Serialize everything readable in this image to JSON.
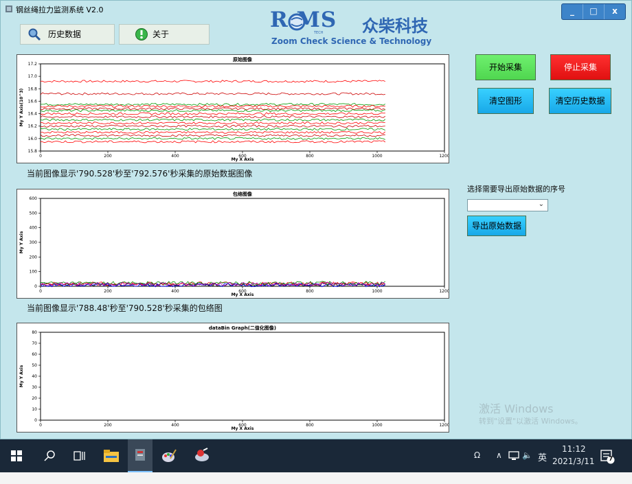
{
  "window": {
    "title": "钢丝绳拉力监测系统 V2.0",
    "controls": [
      "_",
      "□",
      "x"
    ]
  },
  "tabs": [
    {
      "label": "历史数据",
      "icon": "search-icon"
    },
    {
      "label": "关于",
      "icon": "info-icon"
    }
  ],
  "logo": {
    "brand": "R  MS",
    "cn": "众柴科技",
    "sub": "Zoom Check Science & Technology",
    "tech": "TECH"
  },
  "charts": [
    {
      "title": "原始图像",
      "xlabel": "My X Axis",
      "ylabel": "My Y Axis(10^3)",
      "caption": "当前图像显示'790.528'秒至'792.576'秒采集的原始数据图像"
    },
    {
      "title": "包络图像",
      "xlabel": "My X Axis",
      "ylabel": "My Y Axis",
      "caption": "当前图像显示'788.48'秒至'790.528'秒采集的包络图"
    },
    {
      "title": "dataBin Graph(二值化图像)",
      "xlabel": "My X Axis",
      "ylabel": "My Y Axis",
      "caption": ""
    }
  ],
  "chart_data": [
    {
      "type": "line",
      "title": "原始图像",
      "xlabel": "My X Axis",
      "ylabel": "My Y Axis(10^3)",
      "xlim": [
        0,
        1200
      ],
      "ylim": [
        15.8,
        17.2
      ],
      "x_ticks": [
        "0",
        "200",
        "400",
        "600",
        "800",
        "1000",
        "1200"
      ],
      "y_ticks": [
        "15.8",
        "16.0",
        "16.2",
        "16.4",
        "16.6",
        "16.8",
        "17.0",
        "17.2"
      ],
      "series_levels": [
        16.92,
        16.72,
        16.55,
        16.52,
        16.48,
        16.45,
        16.4,
        16.35,
        16.3,
        16.25,
        16.2,
        16.15,
        16.1,
        16.05,
        16.0,
        15.95
      ],
      "series_colors": [
        "#ff0000",
        "#cc0000",
        "#009900"
      ],
      "x_max_data": 1024
    },
    {
      "type": "line",
      "title": "包络图像",
      "xlabel": "My X Axis",
      "ylabel": "My Y Axis",
      "xlim": [
        0,
        1200
      ],
      "ylim": [
        0,
        600
      ],
      "x_ticks": [
        "0",
        "200",
        "400",
        "600",
        "800",
        "1000",
        "1200"
      ],
      "y_ticks": [
        "0",
        "100",
        "200",
        "300",
        "400",
        "500",
        "600"
      ],
      "series_levels": [
        12,
        18,
        8,
        22,
        15
      ],
      "series_colors": [
        "#000000",
        "#ff0000",
        "#0000ff",
        "#008800",
        "#aa00aa"
      ],
      "x_max_data": 1024
    },
    {
      "type": "line",
      "title": "dataBin Graph(二值化图像)",
      "xlabel": "My X Axis",
      "ylabel": "My Y Axis",
      "xlim": [
        0,
        1200
      ],
      "ylim": [
        0,
        80
      ],
      "x_ticks": [
        "0",
        "200",
        "400",
        "600",
        "800",
        "1000",
        "1200"
      ],
      "y_ticks": [
        "0",
        "10",
        "20",
        "30",
        "40",
        "50",
        "60",
        "70",
        "80"
      ],
      "series_levels": [],
      "series_colors": [],
      "x_max_data": 1024
    }
  ],
  "buttons": {
    "start": "开始采集",
    "stop": "停止采集",
    "clear_graph": "清空图形",
    "clear_history": "清空历史数据"
  },
  "export": {
    "label": "选择需要导出原始数据的序号",
    "select_value": "",
    "button": "导出原始数据"
  },
  "watermark": {
    "line1": "激活 Windows",
    "line2": "转到\"设置\"以激活 Windows。"
  },
  "taskbar": {
    "ime": "英",
    "time": "11:12",
    "date": "2021/3/11",
    "notification_count": "7"
  },
  "colors": {
    "app_bg": "#c4e6ec",
    "accent": "#2f67b3",
    "start_green": "#4fd64f",
    "stop_red": "#e01010",
    "action_blue": "#18a8e8",
    "taskbar": "#1a2838"
  }
}
